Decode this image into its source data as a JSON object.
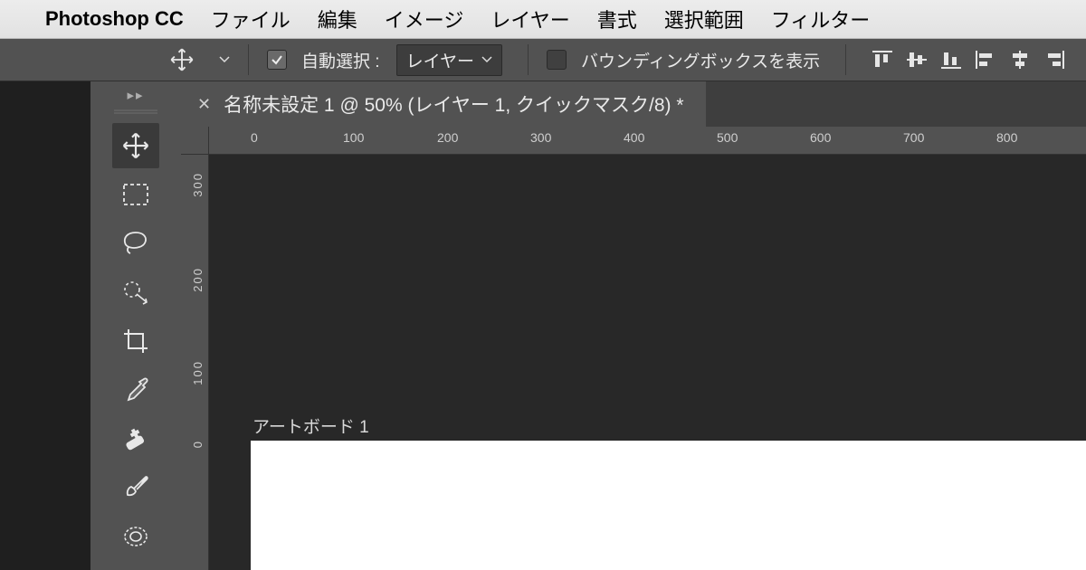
{
  "menubar": {
    "app_name": "Photoshop CC",
    "items": [
      "ファイル",
      "編集",
      "イメージ",
      "レイヤー",
      "書式",
      "選択範囲",
      "フィルター"
    ]
  },
  "options_bar": {
    "auto_select_label": "自動選択 :",
    "auto_select_checked": true,
    "target_dropdown": "レイヤー",
    "show_bbox_label": "バウンディングボックスを表示",
    "show_bbox_checked": false
  },
  "document": {
    "tab_title": "名称未設定 1 @ 50% (レイヤー 1, クイックマスク/8) *",
    "artboard_label": "アートボード 1"
  },
  "rulers": {
    "h_ticks": [
      "0",
      "100",
      "200",
      "300",
      "400",
      "500",
      "600",
      "700",
      "800"
    ],
    "v_ticks": [
      "300",
      "200",
      "100",
      "0"
    ]
  },
  "tools": [
    {
      "name": "move-tool",
      "active": true
    },
    {
      "name": "rect-marquee-tool"
    },
    {
      "name": "lasso-tool"
    },
    {
      "name": "quick-select-tool"
    },
    {
      "name": "crop-tool"
    },
    {
      "name": "eyedropper-tool"
    },
    {
      "name": "healing-brush-tool"
    },
    {
      "name": "brush-tool"
    },
    {
      "name": "clone-stamp-tool"
    }
  ]
}
